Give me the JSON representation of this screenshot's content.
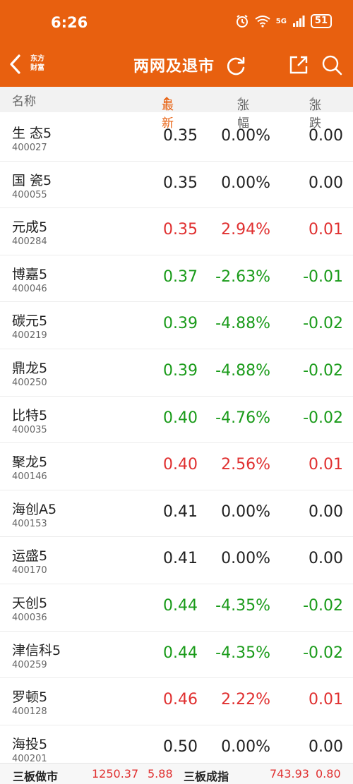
{
  "status": {
    "time": "6:26",
    "signal": "5G",
    "battery": "51"
  },
  "nav": {
    "logo_line1": "东方",
    "logo_line2": "财富",
    "title": "两网及退市"
  },
  "columns": {
    "name": "名称",
    "latest": "最新",
    "latest_sort": "↑",
    "pct": "涨幅",
    "chg": "涨跌"
  },
  "colors": {
    "header": "#e8600f",
    "up": "#e03030",
    "down": "#1a9b1a"
  },
  "rows": [
    {
      "name": "生 态5",
      "code": "400027",
      "price": "0.35",
      "pct": "0.00%",
      "chg": "0.00",
      "trend": "flat"
    },
    {
      "name": "国 瓷5",
      "code": "400055",
      "price": "0.35",
      "pct": "0.00%",
      "chg": "0.00",
      "trend": "flat"
    },
    {
      "name": "元成5",
      "code": "400284",
      "price": "0.35",
      "pct": "2.94%",
      "chg": "0.01",
      "trend": "up"
    },
    {
      "name": "博嘉5",
      "code": "400046",
      "price": "0.37",
      "pct": "-2.63%",
      "chg": "-0.01",
      "trend": "down"
    },
    {
      "name": "碳元5",
      "code": "400219",
      "price": "0.39",
      "pct": "-4.88%",
      "chg": "-0.02",
      "trend": "down"
    },
    {
      "name": "鼎龙5",
      "code": "400250",
      "price": "0.39",
      "pct": "-4.88%",
      "chg": "-0.02",
      "trend": "down"
    },
    {
      "name": "比特5",
      "code": "400035",
      "price": "0.40",
      "pct": "-4.76%",
      "chg": "-0.02",
      "trend": "down"
    },
    {
      "name": "聚龙5",
      "code": "400146",
      "price": "0.40",
      "pct": "2.56%",
      "chg": "0.01",
      "trend": "up"
    },
    {
      "name": "海创A5",
      "code": "400153",
      "price": "0.41",
      "pct": "0.00%",
      "chg": "0.00",
      "trend": "flat"
    },
    {
      "name": "运盛5",
      "code": "400170",
      "price": "0.41",
      "pct": "0.00%",
      "chg": "0.00",
      "trend": "flat"
    },
    {
      "name": "天创5",
      "code": "400036",
      "price": "0.44",
      "pct": "-4.35%",
      "chg": "-0.02",
      "trend": "down"
    },
    {
      "name": "津信科5",
      "code": "400259",
      "price": "0.44",
      "pct": "-4.35%",
      "chg": "-0.02",
      "trend": "down"
    },
    {
      "name": "罗顿5",
      "code": "400128",
      "price": "0.46",
      "pct": "2.22%",
      "chg": "0.01",
      "trend": "up"
    },
    {
      "name": "海投5",
      "code": "400201",
      "price": "0.50",
      "pct": "0.00%",
      "chg": "0.00",
      "trend": "flat"
    }
  ],
  "footer": {
    "index1_name": "三板做市",
    "index1_value": "1250.37",
    "index1_change": "5.88",
    "index2_name": "三板成指",
    "index2_value": "743.93",
    "index2_change": "0.80"
  }
}
